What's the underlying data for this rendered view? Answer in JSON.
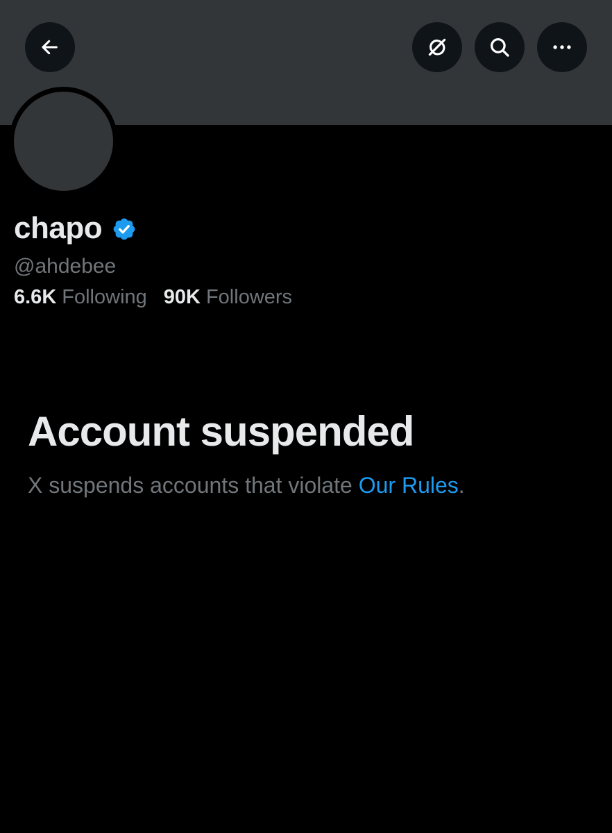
{
  "profile": {
    "display_name": "chapo",
    "handle": "@ahdebee",
    "verified": true,
    "following_count": "6.6K",
    "following_label": "Following",
    "followers_count": "90K",
    "followers_label": "Followers"
  },
  "header": {
    "icons": [
      "back-arrow-icon",
      "grok-icon",
      "search-icon",
      "more-icon"
    ]
  },
  "suspension": {
    "title": "Account suspended",
    "message_prefix": "X suspends accounts that violate ",
    "rules_link": "Our Rules",
    "message_suffix": "."
  },
  "colors": {
    "background": "#000000",
    "banner": "#333639",
    "primary_text": "#e7e9ea",
    "secondary_text": "#71767b",
    "link": "#1d9bf0",
    "verified_badge": "#1d9bf0"
  }
}
